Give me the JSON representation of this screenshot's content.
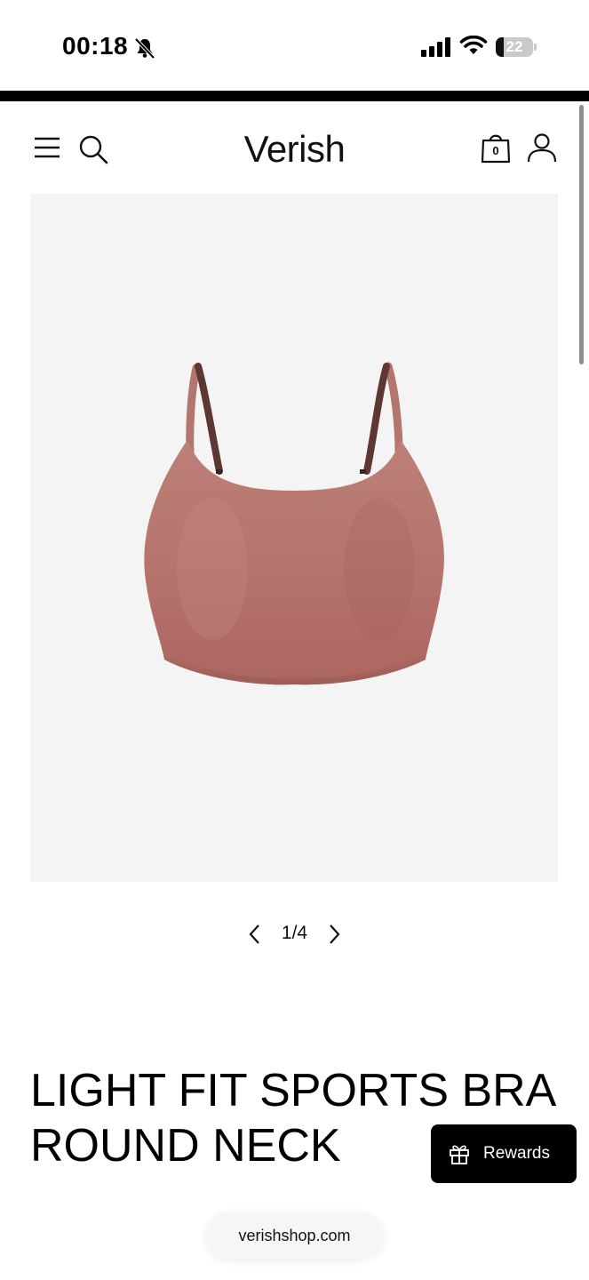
{
  "status_bar": {
    "time": "00:18",
    "battery_percent": "22",
    "battery_level": 0.22
  },
  "header": {
    "brand": "Verish",
    "cart_count": "0"
  },
  "gallery": {
    "image_subject": "dusty-rose sports bra product photo",
    "product_color": "#b9726a",
    "pager": "1/4"
  },
  "product": {
    "title": "LIGHT FIT SPORTS BRA ROUND NECK"
  },
  "rewards": {
    "label": "Rewards"
  },
  "browser": {
    "url": "verishshop.com"
  }
}
